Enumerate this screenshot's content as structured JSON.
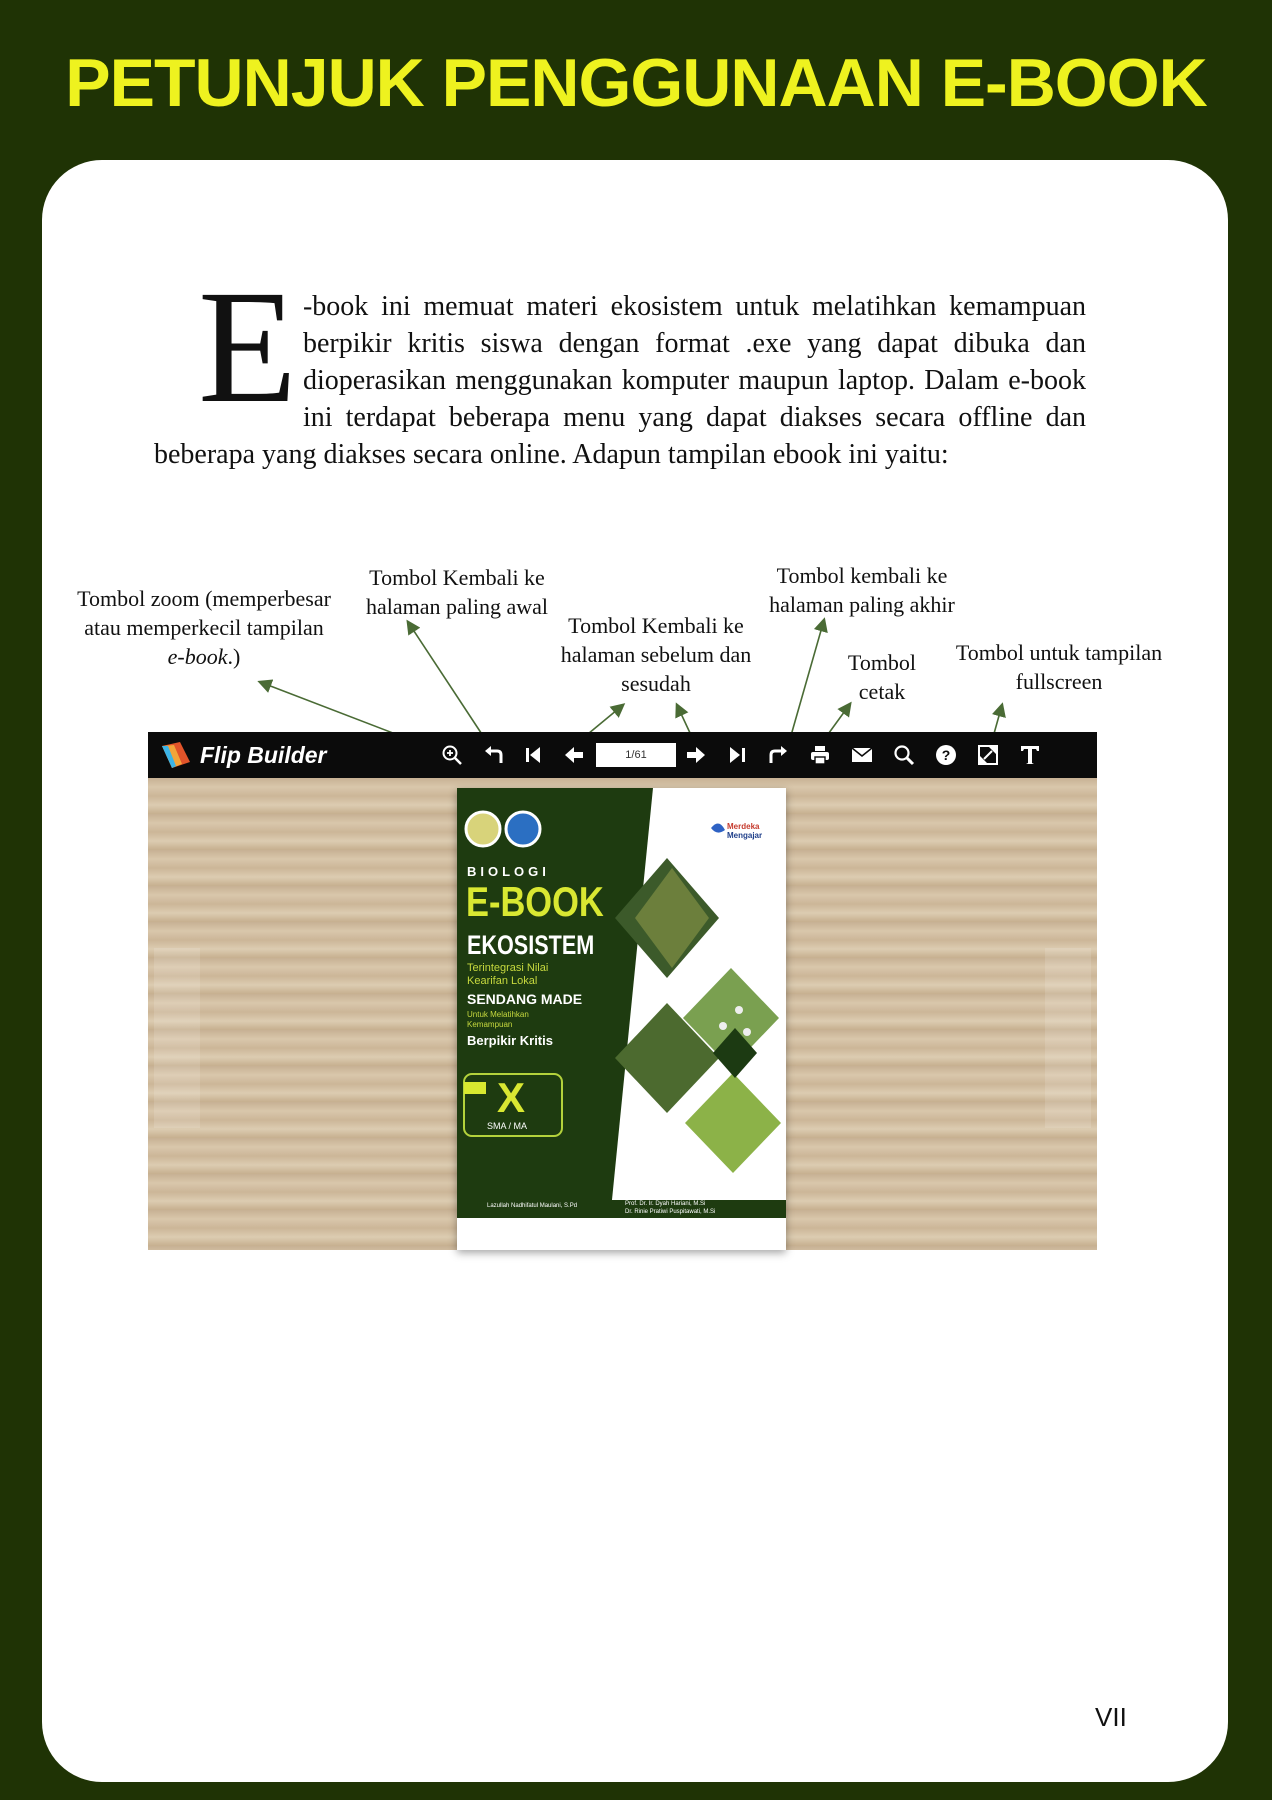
{
  "page": {
    "title": "PETUNJUK PENGGUNAAN E-BOOK",
    "page_number": "VII",
    "colors": {
      "background": "#1f3305",
      "title": "#eef21f",
      "card": "#ffffff",
      "arrow": "#4a6b35"
    }
  },
  "intro": {
    "dropcap": "E",
    "text": "-book ini memuat materi ekosistem untuk melatihkan kemampuan berpikir kritis siswa dengan format .exe yang dapat dibuka dan dioperasikan menggunakan komputer maupun laptop. Dalam e-book ini terdapat beberapa menu yang dapat diakses secara offline dan beberapa yang diakses secara online. Adapun tampilan ebook ini yaitu:"
  },
  "callouts": {
    "zoom": {
      "line1": "Tombol zoom (memperbesar",
      "line2": "atau memperkecil tampilan",
      "line3_italic": "e-book",
      "line3_rest": ".)"
    },
    "first_page": {
      "line1": "Tombol Kembali ke",
      "line2": "halaman paling awal"
    },
    "prev_next": {
      "line1": "Tombol Kembali ke",
      "line2": "halaman sebelum dan",
      "line3": "sesudah"
    },
    "last_page": {
      "line1": "Tombol kembali ke",
      "line2": "halaman paling akhir"
    },
    "print": {
      "line1": "Tombol",
      "line2": "cetak"
    },
    "fullscreen": {
      "line1": "Tombol untuk tampilan",
      "line2": "fullscreen"
    }
  },
  "viewer": {
    "brand": "Flip Builder",
    "page_indicator": "1/61",
    "toolbar_icons": [
      "zoom-in-icon",
      "back-icon",
      "first-page-icon",
      "prev-page-icon",
      "next-page-icon",
      "last-page-icon",
      "forward-icon",
      "print-icon",
      "email-icon",
      "search-icon",
      "help-icon",
      "fullscreen-icon",
      "text-icon"
    ]
  },
  "cover": {
    "subject": "BIOLOGI",
    "title": "E-BOOK",
    "topic": "EKOSISTEM",
    "sub1": "Terintegrasi Nilai",
    "sub2": "Kearifan Lokal",
    "local": "SENDANG MADE",
    "sub3": "Untuk Melatihkan",
    "sub4": "Kemampuan",
    "skill": "Berpikir Kritis",
    "grade": "X",
    "level": "SMA / MA",
    "brand1": "Merdeka",
    "brand2": "Mengajar",
    "author": "Lazullah Nadhifatul Maulani, S.Pd",
    "supervisor1": "Prof. Dr. Ir. Dyah Hariani, M.Si",
    "supervisor2": "Dr. Rinie Pratiwi Puspitawati, M.Si"
  }
}
